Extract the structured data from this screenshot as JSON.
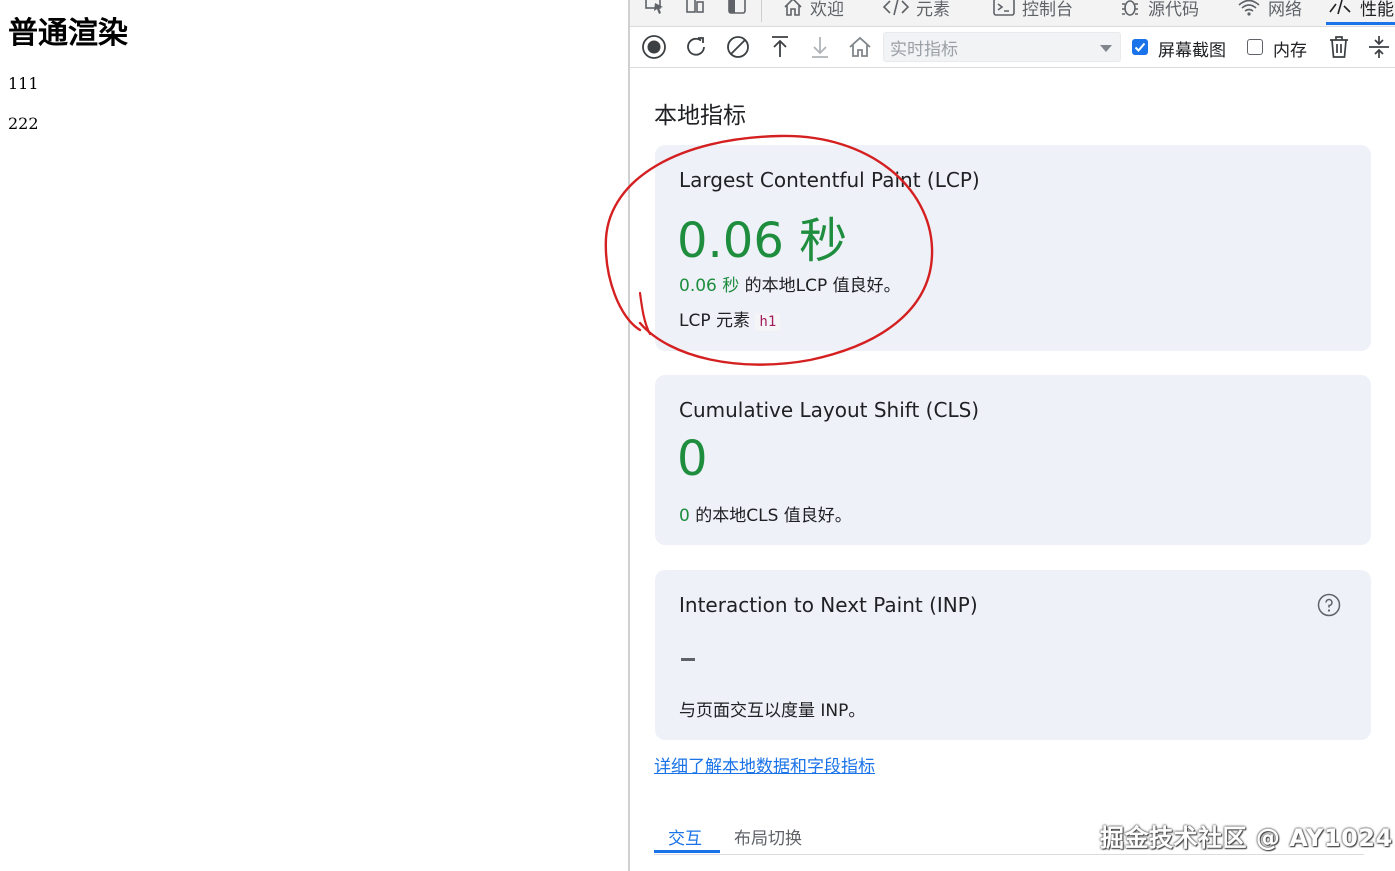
{
  "page": {
    "heading": "普通渲染",
    "lines": [
      "111",
      "222"
    ]
  },
  "devtools": {
    "tabs": [
      {
        "label": "欢迎",
        "icon": "home-icon"
      },
      {
        "label": "元素",
        "icon": "code-icon"
      },
      {
        "label": "控制台",
        "icon": "terminal-icon"
      },
      {
        "label": "源代码",
        "icon": "bug-icon"
      },
      {
        "label": "网络",
        "icon": "wifi-icon"
      },
      {
        "label": "性能",
        "icon": "performance-icon",
        "active": true
      }
    ],
    "toolbar": {
      "select_value": "实时指标",
      "screenshot_label": "屏幕截图",
      "screenshot_checked": true,
      "memory_label": "内存",
      "memory_checked": false
    },
    "section_title": "本地指标",
    "metrics": {
      "lcp": {
        "title": "Largest Contentful Paint (LCP)",
        "value": "0.06 秒",
        "desc_value": "0.06 秒",
        "desc_text": " 的本地LCP 值良好。",
        "element_label": "LCP 元素",
        "element_tag": "h1"
      },
      "cls": {
        "title": "Cumulative Layout Shift (CLS)",
        "value": "0",
        "desc_value": "0",
        "desc_text": " 的本地CLS 值良好。"
      },
      "inp": {
        "title": "Interaction to Next Paint (INP)",
        "desc": "与页面交互以度量 INP。"
      }
    },
    "learn_more_link": "详细了解本地数据和字段指标",
    "bottom_tabs": [
      "交互",
      "布局切换"
    ]
  },
  "watermark": "掘金技术社区 @ AY1024",
  "colors": {
    "accent": "#1a73e8",
    "good": "#1e8e3e",
    "card_bg": "#eef1f8",
    "annotation": "#d42020"
  }
}
